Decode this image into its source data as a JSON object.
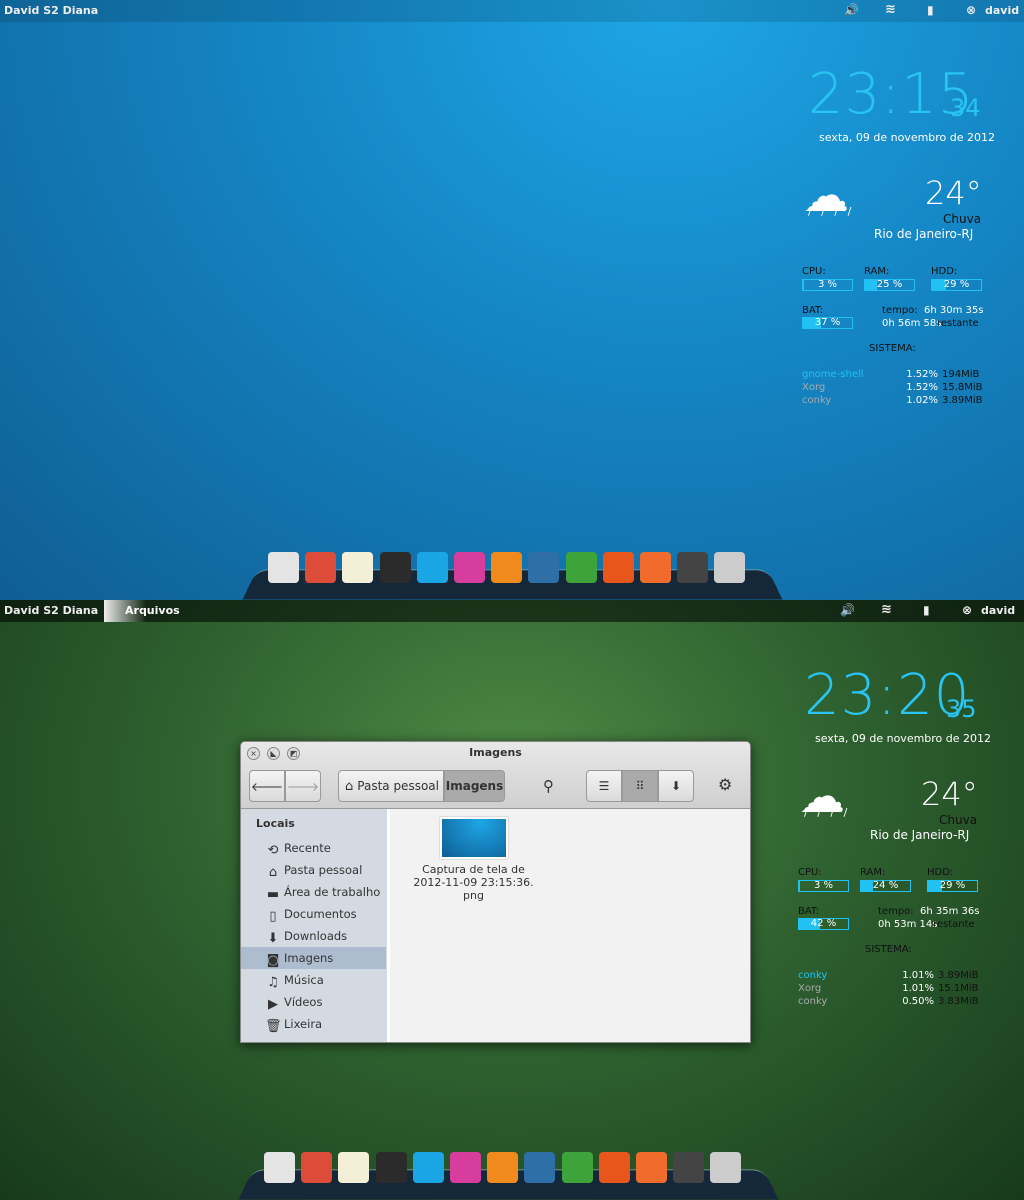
{
  "screens": [
    {
      "panel": {
        "user_label": "David S2 Diana",
        "app_menu": "",
        "account": "david"
      },
      "conky": {
        "hours": "23:15",
        "seconds": "34",
        "date": "sexta, 09 de novembro de 2012",
        "temp": "24°",
        "condition": "Chuva",
        "city": "Rio de Janeiro-RJ",
        "cpu_label": "CPU:",
        "cpu": "3 %",
        "cpu_pct": 3,
        "ram_label": "RAM:",
        "ram": "25 %",
        "ram_pct": 25,
        "hdd_label": "HDD:",
        "hdd": "29 %",
        "hdd_pct": 29,
        "bat_label": "BAT:",
        "bat": "37 %",
        "bat_pct": 37,
        "tempo_label": "tempo:",
        "tempo": "6h 30m 35s",
        "remaining": "0h 56m 58s",
        "remaining_label": "restante",
        "sistema": "SISTEMA:",
        "processes": [
          {
            "name": "gnome-shell",
            "cpu": "1.52%",
            "mem": "194MiB"
          },
          {
            "name": "Xorg",
            "cpu": "1.52%",
            "mem": "15.8MiB"
          },
          {
            "name": "conky",
            "cpu": "1.02%",
            "mem": "3.89MiB"
          }
        ]
      }
    },
    {
      "panel": {
        "user_label": "David S2 Diana",
        "app_menu": "Arquivos",
        "account": "david"
      },
      "conky": {
        "hours": "23:20",
        "seconds": "35",
        "date": "sexta, 09 de novembro de 2012",
        "temp": "24°",
        "condition": "Chuva",
        "city": "Rio de Janeiro-RJ",
        "cpu_label": "CPU:",
        "cpu": "3 %",
        "cpu_pct": 3,
        "ram_label": "RAM:",
        "ram": "24 %",
        "ram_pct": 24,
        "hdd_label": "HDD:",
        "hdd": "29 %",
        "hdd_pct": 29,
        "bat_label": "BAT:",
        "bat": "42 %",
        "bat_pct": 42,
        "tempo_label": "tempo:",
        "tempo": "6h 35m 36s",
        "remaining": "0h 53m 14s",
        "remaining_label": "restante",
        "sistema": "SISTEMA:",
        "processes": [
          {
            "name": "conky",
            "cpu": "1.01%",
            "mem": "3.89MiB"
          },
          {
            "name": "Xorg",
            "cpu": "1.01%",
            "mem": "15.1MiB"
          },
          {
            "name": "conky",
            "cpu": "0.50%",
            "mem": "3.83MiB"
          }
        ]
      }
    }
  ],
  "colors": {
    "accent": "#21c2f3"
  },
  "dock": [
    {
      "name": "files",
      "color": "#e4e4e4"
    },
    {
      "name": "chrome",
      "color": "#dd4b39"
    },
    {
      "name": "text-editor",
      "color": "#f4f0d8"
    },
    {
      "name": "terminal",
      "color": "#2b2b2b"
    },
    {
      "name": "skype",
      "color": "#1aa6e4"
    },
    {
      "name": "xmind",
      "color": "#d63d9c"
    },
    {
      "name": "media-player",
      "color": "#f08a1c"
    },
    {
      "name": "writer",
      "color": "#2f6fa8"
    },
    {
      "name": "calc",
      "color": "#3da33a"
    },
    {
      "name": "ubuntu-one",
      "color": "#e8561c"
    },
    {
      "name": "system-settings",
      "color": "#f06c2c"
    },
    {
      "name": "tweak-tool",
      "color": "#444"
    },
    {
      "name": "trash",
      "color": "#ccc"
    }
  ],
  "file_manager": {
    "title": "Imagens",
    "breadcrumb": [
      "Pasta pessoal",
      "Imagens"
    ],
    "sidebar_heading": "Locais",
    "sidebar": [
      {
        "label": "Recente",
        "icon": "history-icon",
        "glyph": "⟲"
      },
      {
        "label": "Pasta pessoal",
        "icon": "home-icon",
        "glyph": "⌂"
      },
      {
        "label": "Área de trabalho",
        "icon": "folder-icon",
        "glyph": "▬"
      },
      {
        "label": "Documentos",
        "icon": "document-icon",
        "glyph": "▯"
      },
      {
        "label": "Downloads",
        "icon": "download-icon",
        "glyph": "⬇"
      },
      {
        "label": "Imagens",
        "icon": "camera-icon",
        "glyph": "◙",
        "selected": true
      },
      {
        "label": "Música",
        "icon": "music-icon",
        "glyph": "♫"
      },
      {
        "label": "Vídeos",
        "icon": "video-camera-icon",
        "glyph": "▶"
      },
      {
        "label": "Lixeira",
        "icon": "trash-icon",
        "glyph": "🗑"
      }
    ],
    "files": [
      {
        "name_line1": "Captura de tela de",
        "name_line2": "2012-11-09 23:15:36.",
        "name_line3": "png"
      }
    ]
  }
}
